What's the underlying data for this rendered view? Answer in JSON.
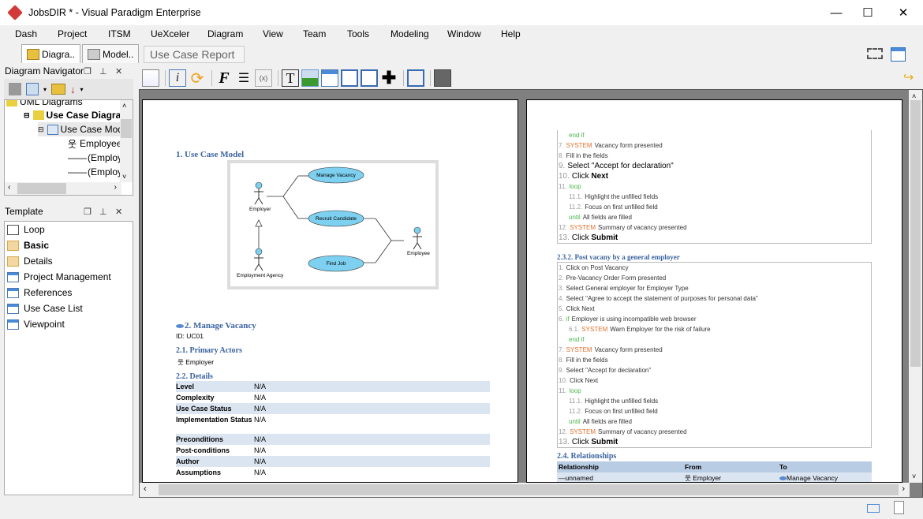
{
  "window": {
    "title": "JobsDIR * - Visual Paradigm Enterprise",
    "minimize": "—",
    "maximize": "☐",
    "close": "✕"
  },
  "menu": [
    "Dash",
    "Project",
    "ITSM",
    "UeXceler",
    "Diagram",
    "View",
    "Team",
    "Tools",
    "Modeling",
    "Window",
    "Help"
  ],
  "left_tabs": [
    {
      "label": "Diagra.."
    },
    {
      "label": "Model.."
    }
  ],
  "navigator": {
    "title": "Diagram Navigator",
    "tree": [
      {
        "label": "UML Diagrams",
        "level": 0
      },
      {
        "label": "Use Case Diagra",
        "level": 1,
        "bold": true
      },
      {
        "label": "Use Case Mode",
        "level": 2
      },
      {
        "label": "Employee",
        "level": 3,
        "icon": "actor"
      },
      {
        "label": "(Employee",
        "level": 3,
        "icon": "line"
      },
      {
        "label": "(Employee",
        "level": 3,
        "icon": "line"
      }
    ]
  },
  "template": {
    "title": "Template",
    "items": [
      {
        "label": "Loop",
        "icon": "loop"
      },
      {
        "label": "Basic",
        "icon": "basic",
        "bold": true
      },
      {
        "label": "Details",
        "icon": "basic"
      },
      {
        "label": "Project Management",
        "icon": "table"
      },
      {
        "label": "References",
        "icon": "table"
      },
      {
        "label": "Use Case List",
        "icon": "table"
      },
      {
        "label": "Viewpoint",
        "icon": "table"
      }
    ]
  },
  "breadcrumb": "Use Case Report",
  "toolbar": {
    "italic_i": "i",
    "format_f": "F",
    "text_t": "T"
  },
  "page1": {
    "h_model": "1. Use Case Model",
    "diagram": {
      "usecases": [
        "Manage Vacancy",
        "Recruit Candidate",
        "Find Job"
      ],
      "actors": [
        "Employer",
        "Employment Agency",
        "Employee"
      ]
    },
    "h_manage": "2. Manage Vacancy",
    "id": "ID: UC01",
    "h_actors": "2.1. Primary Actors",
    "actor": "Employer",
    "h_details": "2.2. Details",
    "details": [
      {
        "k": "Level",
        "v": "N/A"
      },
      {
        "k": "Complexity",
        "v": "N/A"
      },
      {
        "k": "Use Case Status",
        "v": "N/A"
      },
      {
        "k": "Implementation Status",
        "v": "N/A"
      },
      {
        "k": "Preconditions",
        "v": "N/A"
      },
      {
        "k": "Post-conditions",
        "v": "N/A"
      },
      {
        "k": "Author",
        "v": "N/A"
      },
      {
        "k": "Assumptions",
        "v": "N/A"
      }
    ]
  },
  "page2": {
    "top_steps": [
      {
        "indent": 1,
        "kw": "end if",
        "text": ""
      },
      {
        "num": "7.",
        "sys": "SYSTEM",
        "text": "Vacancy form presented"
      },
      {
        "num": "8.",
        "text": "Fill in the fields"
      },
      {
        "num": "9.",
        "text": "Select \"Accept for declaration\"",
        "big": true
      },
      {
        "num": "10.",
        "text": "Click Next",
        "big": true,
        "boldword": "Next"
      },
      {
        "num": "11.",
        "kw": "loop",
        "text": ""
      },
      {
        "indent": 1,
        "num": "11.1.",
        "text": "Highlight the unfilled fields"
      },
      {
        "indent": 1,
        "num": "11.2.",
        "text": "Focus on first unfilled field"
      },
      {
        "indent": 1,
        "kw": "until",
        "text": "All fields are filled"
      },
      {
        "num": "12.",
        "sys": "SYSTEM",
        "text": "Summary of vacancy presented"
      },
      {
        "num": "13.",
        "text": "Click Submit",
        "big": true,
        "boldword": "Submit"
      }
    ],
    "h_post": "2.3.2. Post vacany by a general employer",
    "post_steps": [
      {
        "num": "1.",
        "text": "Click on Post Vacancy"
      },
      {
        "num": "2.",
        "text": "Pre-Vacancy Order Form presented"
      },
      {
        "num": "3.",
        "text": "Select General employer for Employer Type"
      },
      {
        "num": "4.",
        "text": "Select \"Agree to accept the statement of purposes for personal data\""
      },
      {
        "num": "5.",
        "text": "Click Next"
      },
      {
        "num": "6.",
        "kw": "if",
        "text": "Employer is using incompatible web browser"
      },
      {
        "indent": 1,
        "num": "6.1.",
        "sys": "SYSTEM",
        "text": "Warn Employer for the risk of failure"
      },
      {
        "indent": 1,
        "kw": "end if",
        "text": ""
      },
      {
        "num": "7.",
        "sys": "SYSTEM",
        "text": "Vacancy form presented"
      },
      {
        "num": "8.",
        "text": "Fill in the fields"
      },
      {
        "num": "9.",
        "text": "Select \"Accept for declaration\""
      },
      {
        "num": "10.",
        "text": "Click Next"
      },
      {
        "num": "11.",
        "kw": "loop",
        "text": ""
      },
      {
        "indent": 1,
        "num": "11.1.",
        "text": "Highlight the unfilled fields"
      },
      {
        "indent": 1,
        "num": "11.2.",
        "text": "Focus on first unfilled field"
      },
      {
        "indent": 1,
        "kw": "until",
        "text": "All fields are filled"
      },
      {
        "num": "12.",
        "sys": "SYSTEM",
        "text": "Summary of vacancy presented"
      },
      {
        "num": "13.",
        "text": "Click Submit",
        "big": true,
        "boldword": "Submit"
      }
    ],
    "h_rel": "2.4. Relationships",
    "rel_headers": [
      "Relationship",
      "From",
      "To"
    ],
    "rel_rows": [
      [
        "unnamed",
        "Employer",
        "Manage Vacancy"
      ]
    ]
  }
}
